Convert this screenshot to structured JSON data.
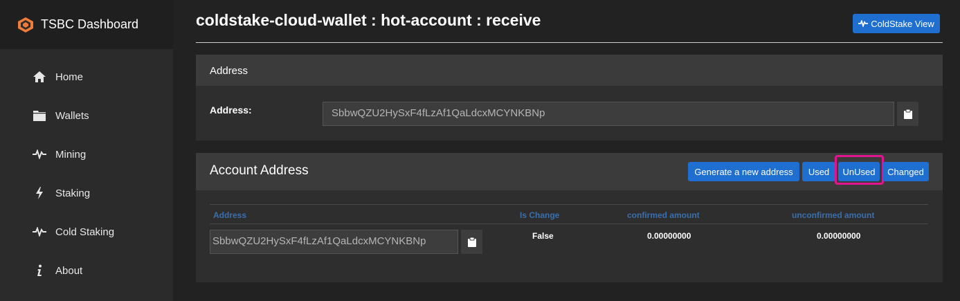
{
  "app": {
    "title": "TSBC Dashboard"
  },
  "sidebar": {
    "items": [
      {
        "label": "Home",
        "icon": "home-icon"
      },
      {
        "label": "Wallets",
        "icon": "folder-icon"
      },
      {
        "label": "Mining",
        "icon": "pulse-icon"
      },
      {
        "label": "Staking",
        "icon": "bolt-icon"
      },
      {
        "label": "Cold Staking",
        "icon": "pulse-icon"
      },
      {
        "label": "About",
        "icon": "info-icon"
      }
    ]
  },
  "header": {
    "title": "coldstake-cloud-wallet : hot-account : receive",
    "coldstake_view_label": "ColdStake View"
  },
  "address_panel": {
    "heading": "Address",
    "label": "Address:",
    "value": "SbbwQZU2HySxF4fLzAf1QaLdcxMCYNKBNp"
  },
  "account_panel": {
    "heading": "Account Address",
    "buttons": {
      "generate": "Generate a new address",
      "used": "Used",
      "unused": "UnUsed",
      "changed": "Changed"
    },
    "columns": [
      "Address",
      "Is Change",
      "confirmed amount",
      "unconfirmed amount"
    ],
    "rows": [
      {
        "address": "SbbwQZU2HySxF4fLzAf1QaLdcxMCYNKBNp",
        "is_change": "False",
        "confirmed": "0.00000000",
        "unconfirmed": "0.00000000"
      }
    ]
  },
  "colors": {
    "accent": "#1f6fd1",
    "highlight": "#e0158f",
    "column_header": "#3a6fae"
  }
}
